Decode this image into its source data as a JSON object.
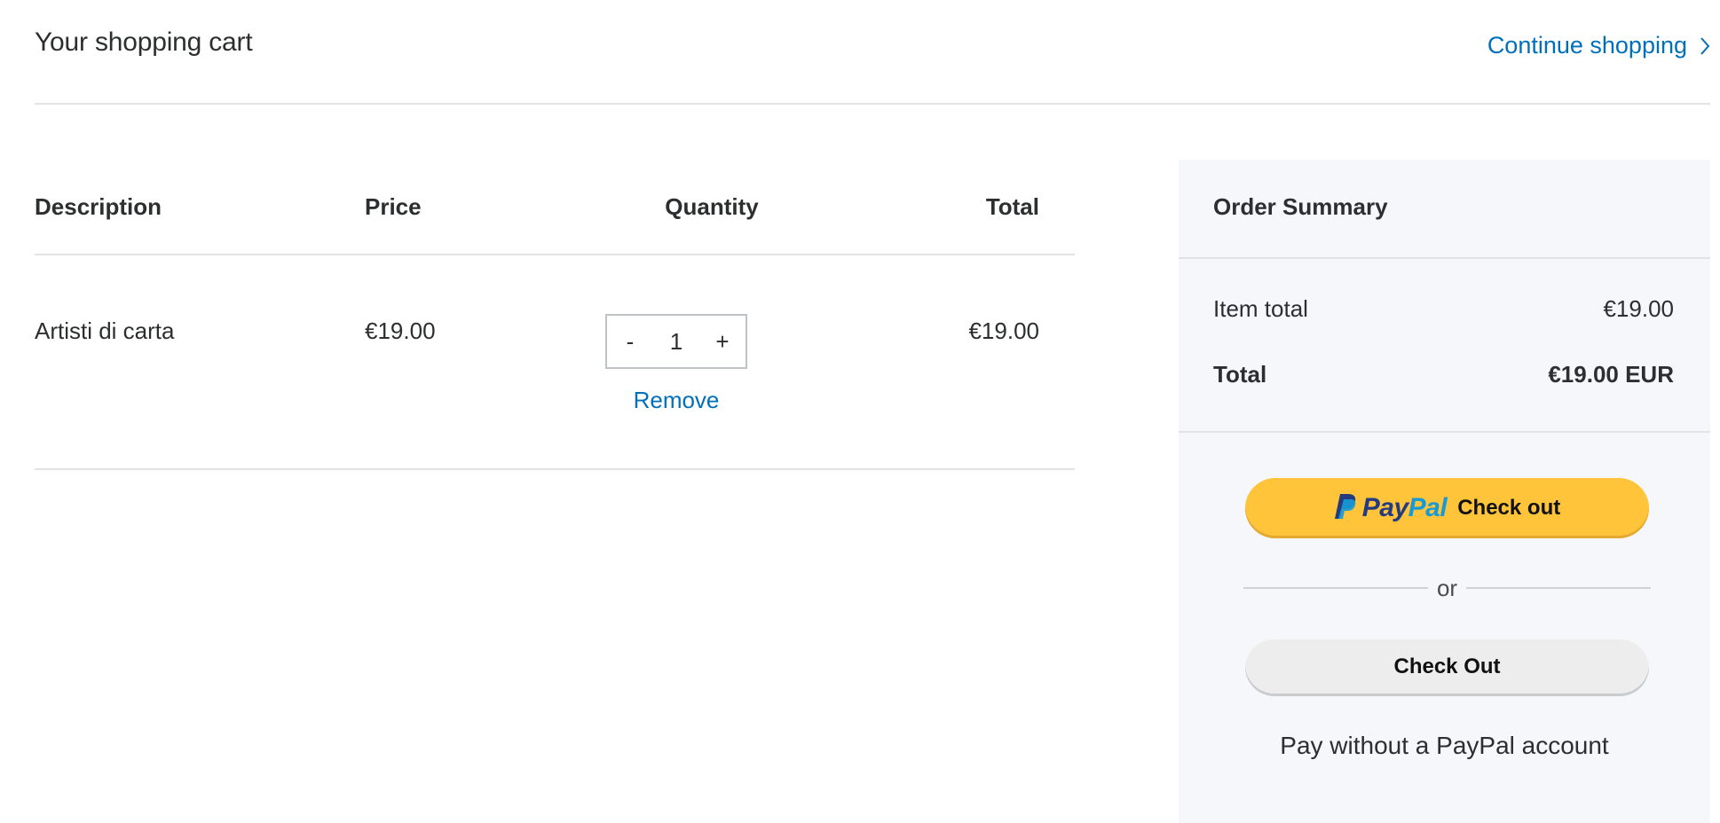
{
  "header": {
    "title": "Your shopping cart",
    "continue_label": "Continue shopping"
  },
  "cart": {
    "columns": {
      "description": "Description",
      "price": "Price",
      "quantity": "Quantity",
      "total": "Total"
    },
    "items": [
      {
        "description": "Artisti di carta",
        "price": "€19.00",
        "quantity": "1",
        "decrement_label": "-",
        "increment_label": "+",
        "total": "€19.00",
        "remove_label": "Remove"
      }
    ]
  },
  "summary": {
    "title": "Order Summary",
    "item_total_label": "Item total",
    "item_total_value": "€19.00",
    "total_label": "Total",
    "total_value": "€19.00 EUR",
    "paypal_brand_pay": "Pay",
    "paypal_brand_pal": "Pal",
    "paypal_checkout_label": "Check out",
    "or_label": "or",
    "checkout_label": "Check Out",
    "pay_without_label": "Pay without a PayPal account"
  },
  "colors": {
    "link": "#0070ba",
    "paypal_button": "#ffc439",
    "paypal_dark_blue": "#253b80",
    "paypal_light_blue": "#179bd7",
    "summary_background": "#f5f7fa",
    "divider": "#e1e3e5"
  },
  "icons": {
    "continue": "chevron-right-icon",
    "paypal": "paypal-logo-icon"
  }
}
